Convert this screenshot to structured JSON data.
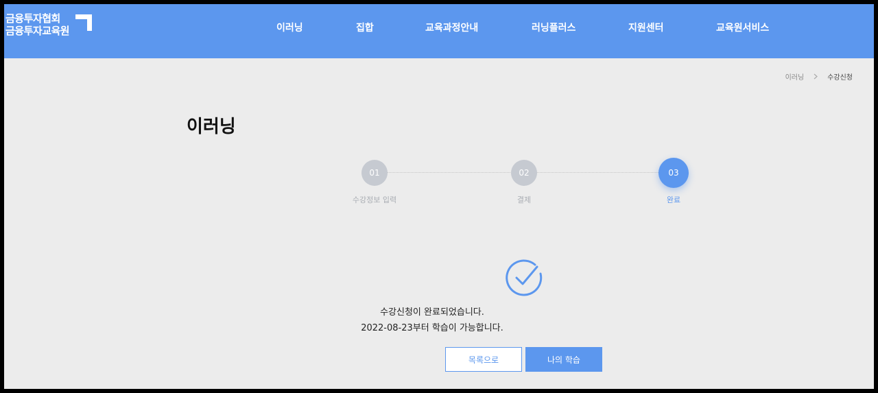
{
  "brand": {
    "line1": "금융투자협회",
    "line2": "금융투자교육원",
    "color": "#5c97ee"
  },
  "nav": {
    "items": [
      "이러닝",
      "집합",
      "교육과정안내",
      "러닝플러스",
      "지원센터",
      "교육원서비스"
    ]
  },
  "breadcrumb": {
    "items": [
      "이러닝",
      "수강신청"
    ],
    "separator_icon": "chevron-right-icon"
  },
  "page": {
    "title": "이러닝"
  },
  "steps": [
    {
      "number": "01",
      "label": "수강정보 입력",
      "state": "done"
    },
    {
      "number": "02",
      "label": "결제",
      "state": "done"
    },
    {
      "number": "03",
      "label": "완료",
      "state": "active"
    }
  ],
  "result": {
    "icon": "check-circle-icon",
    "line1": "수강신청이 완료되었습니다.",
    "line2": "2022-08-23부터 학습이 가능합니다."
  },
  "buttons": {
    "list": "목록으로",
    "my_learning": "나의 학습"
  }
}
